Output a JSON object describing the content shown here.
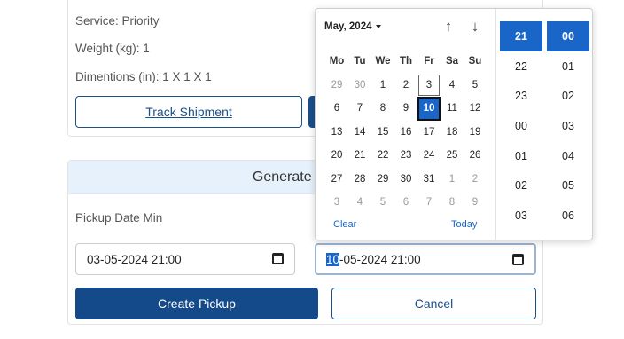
{
  "shipment": {
    "service": "Service: Priority",
    "weight": "Weight (kg): 1",
    "dimensions": "Dimentions (in): 1 X 1 X 1",
    "track_button": "Track Shipment"
  },
  "pickup": {
    "header": "Generate Pickup",
    "date_min_label": "Pickup Date Min",
    "date_min_value": "03-05-2024 21:00",
    "date_max_selected_part": "10",
    "date_max_rest": "-05-2024 21:00",
    "create_button": "Create Pickup",
    "cancel_button": "Cancel"
  },
  "picker": {
    "month_label": "May, 2024",
    "weekdays": [
      "Mo",
      "Tu",
      "We",
      "Th",
      "Fr",
      "Sa",
      "Su"
    ],
    "days": [
      {
        "d": "29",
        "o": true
      },
      {
        "d": "30",
        "o": true
      },
      {
        "d": "1"
      },
      {
        "d": "2"
      },
      {
        "d": "3",
        "today": true
      },
      {
        "d": "4"
      },
      {
        "d": "5"
      },
      {
        "d": "6"
      },
      {
        "d": "7"
      },
      {
        "d": "8"
      },
      {
        "d": "9"
      },
      {
        "d": "10",
        "sel": true
      },
      {
        "d": "11"
      },
      {
        "d": "12"
      },
      {
        "d": "13"
      },
      {
        "d": "14"
      },
      {
        "d": "15"
      },
      {
        "d": "16"
      },
      {
        "d": "17"
      },
      {
        "d": "18"
      },
      {
        "d": "19"
      },
      {
        "d": "20"
      },
      {
        "d": "21"
      },
      {
        "d": "22"
      },
      {
        "d": "23"
      },
      {
        "d": "24"
      },
      {
        "d": "25"
      },
      {
        "d": "26"
      },
      {
        "d": "27"
      },
      {
        "d": "28"
      },
      {
        "d": "29"
      },
      {
        "d": "30"
      },
      {
        "d": "31"
      },
      {
        "d": "1",
        "o": true
      },
      {
        "d": "2",
        "o": true
      },
      {
        "d": "3",
        "o": true
      },
      {
        "d": "4",
        "o": true
      },
      {
        "d": "5",
        "o": true
      },
      {
        "d": "6",
        "o": true
      },
      {
        "d": "7",
        "o": true
      },
      {
        "d": "8",
        "o": true
      },
      {
        "d": "9",
        "o": true
      }
    ],
    "clear_label": "Clear",
    "today_label": "Today",
    "hours": [
      "21",
      "22",
      "23",
      "00",
      "01",
      "02",
      "03"
    ],
    "minutes": [
      "00",
      "01",
      "02",
      "03",
      "04",
      "05",
      "06"
    ],
    "selected_hour": "21",
    "selected_minute": "00"
  },
  "icons": {
    "calendar": "calendar-icon",
    "up": "arrow-up-icon",
    "down": "arrow-down-icon",
    "dropdown": "caret-down-icon"
  },
  "colors": {
    "primary": "#154a8a",
    "selected": "#1a66c8",
    "header_bg": "#e6f1fb"
  }
}
